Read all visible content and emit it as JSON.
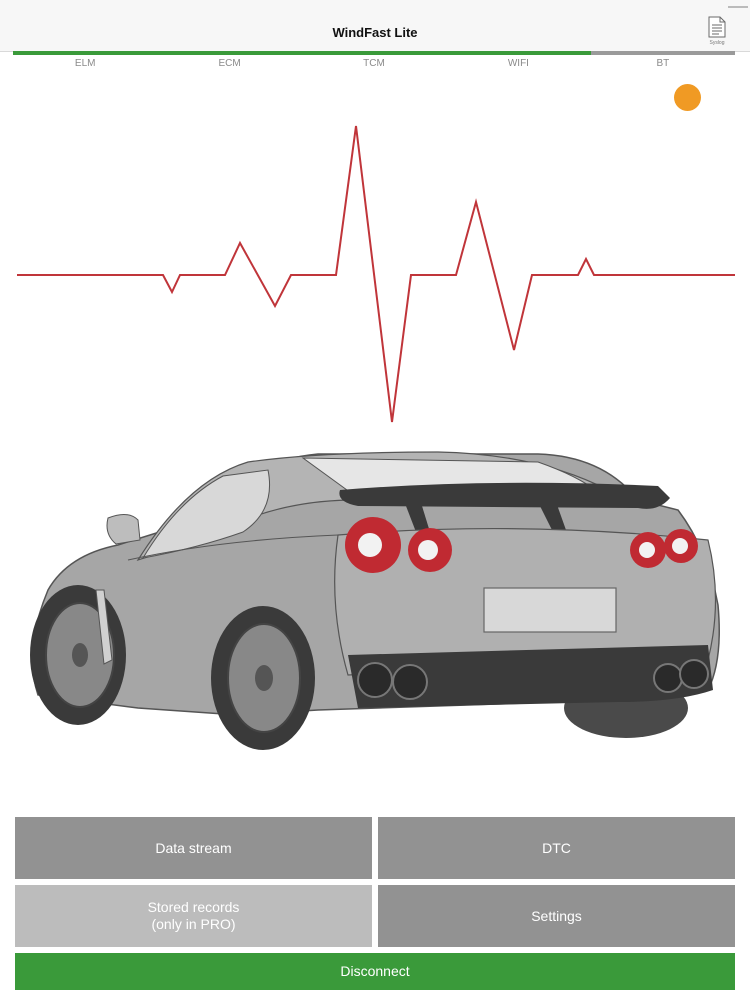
{
  "app": {
    "title": "WindFast Lite"
  },
  "nav": {
    "log_label": "Syslog",
    "log_icon": "document-icon"
  },
  "connection": {
    "stages": [
      "ELM",
      "ECM",
      "TCM",
      "WIFI",
      "BT"
    ],
    "progress": 0.8,
    "progress_color": "#3a9a3a",
    "indicator_color": "#f09a24"
  },
  "buttons": {
    "data_stream": "Data stream",
    "dtc": "DTC",
    "stored_records": "Stored records\n(only in PRO)",
    "settings": "Settings",
    "disconnect": "Disconnect"
  },
  "colors": {
    "heartbeat": "#c0353a",
    "button_gray": "#929292",
    "button_disabled": "#bcbcbc"
  }
}
